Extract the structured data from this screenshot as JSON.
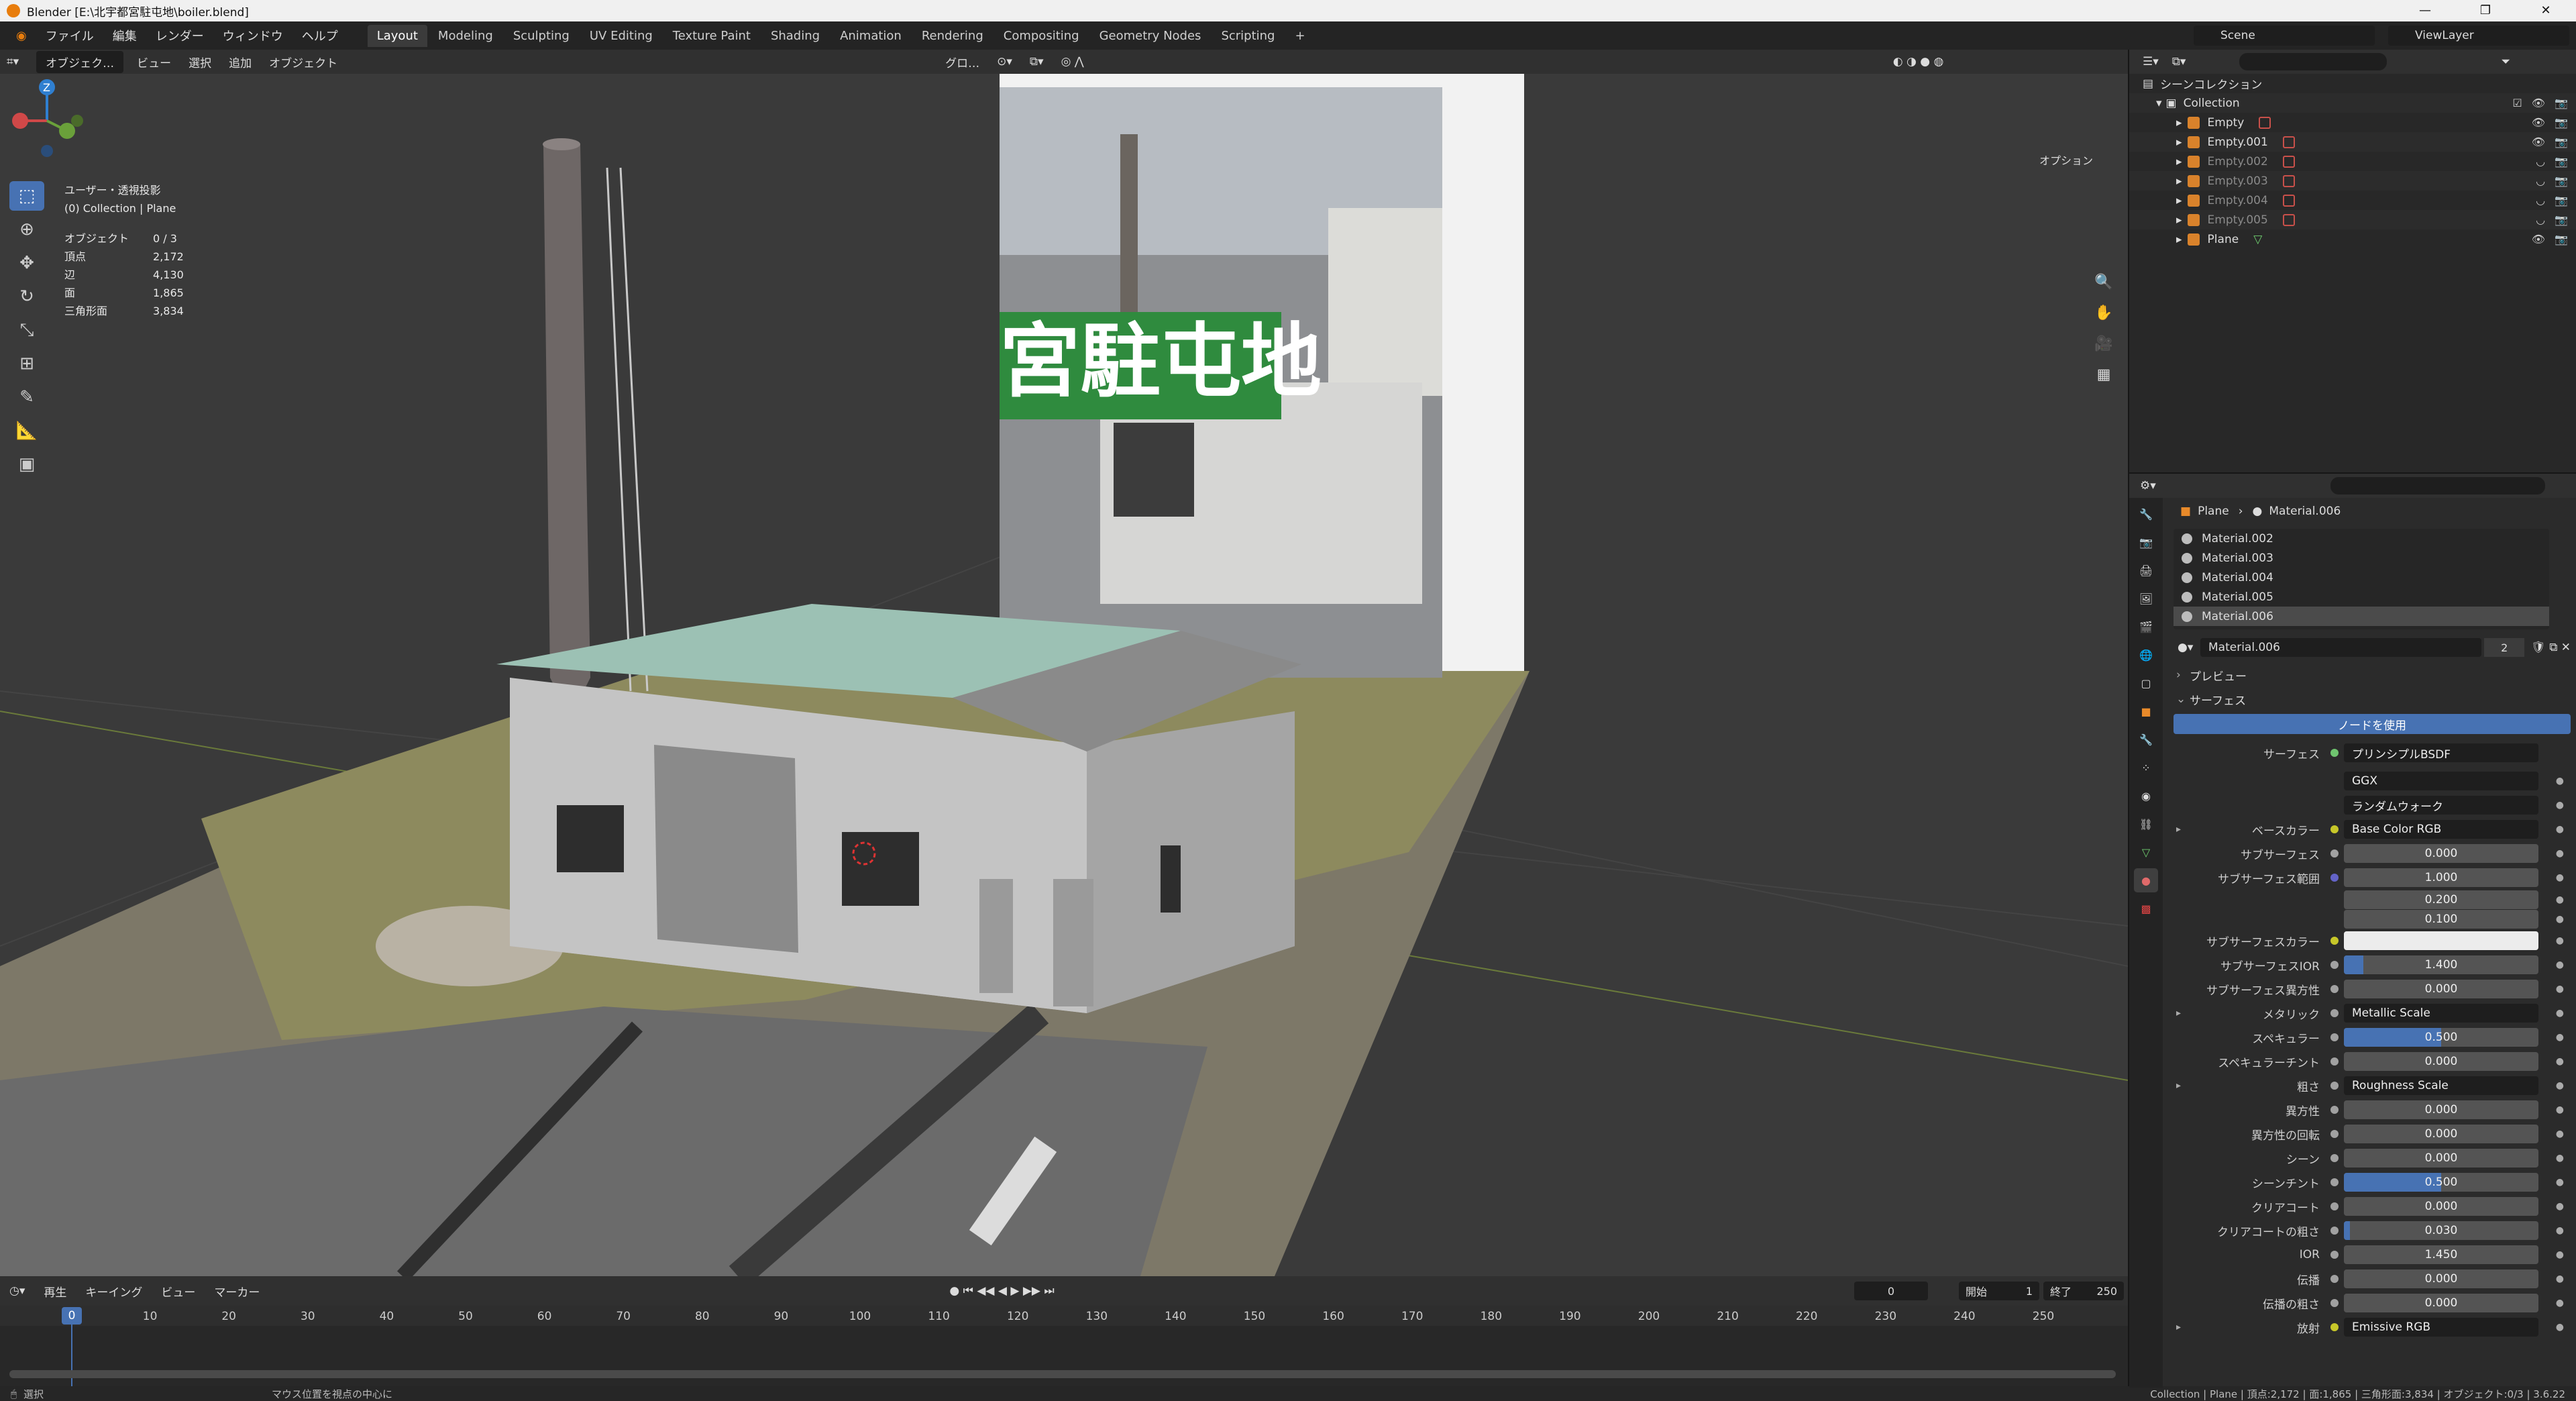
{
  "window": {
    "title": "Blender [E:\\北宇都宮駐屯地\\boiler.blend]"
  },
  "menu": [
    "ファイル",
    "編集",
    "レンダー",
    "ウィンドウ",
    "ヘルプ"
  ],
  "workspaces": [
    {
      "label": "Layout",
      "active": true
    },
    {
      "label": "Modeling"
    },
    {
      "label": "Sculpting"
    },
    {
      "label": "UV Editing"
    },
    {
      "label": "Texture Paint"
    },
    {
      "label": "Shading"
    },
    {
      "label": "Animation"
    },
    {
      "label": "Rendering"
    },
    {
      "label": "Compositing"
    },
    {
      "label": "Geometry Nodes"
    },
    {
      "label": "Scripting"
    }
  ],
  "scene": "Scene",
  "view_layer": "ViewLayer",
  "viewport_header": {
    "mode": "オブジェク…",
    "items": [
      "ビュー",
      "選択",
      "追加",
      "オブジェクト"
    ],
    "transform": "グロ…",
    "options": "オプション"
  },
  "viewport_info": {
    "view_name": "ユーザー・透視投影",
    "collection": "(0) Collection | Plane",
    "stats": [
      {
        "label": "オブジェクト",
        "value": "0 / 3"
      },
      {
        "label": "頂点",
        "value": "2,172"
      },
      {
        "label": "辺",
        "value": "4,130"
      },
      {
        "label": "面",
        "value": "1,865"
      },
      {
        "label": "三角形面",
        "value": "3,834"
      }
    ]
  },
  "billboard_text": "宮駐屯地",
  "outliner": {
    "root": "シーンコレクション",
    "collection": "Collection",
    "items": [
      {
        "name": "Empty",
        "dim": false
      },
      {
        "name": "Empty.001",
        "dim": false
      },
      {
        "name": "Empty.002",
        "dim": true
      },
      {
        "name": "Empty.003",
        "dim": true
      },
      {
        "name": "Empty.004",
        "dim": true
      },
      {
        "name": "Empty.005",
        "dim": true
      },
      {
        "name": "Plane",
        "dim": false
      }
    ]
  },
  "properties": {
    "breadcrumb_object": "Plane",
    "breadcrumb_material": "Material.006",
    "slots": [
      "Material.002",
      "Material.003",
      "Material.004",
      "Material.005",
      "Material.006"
    ],
    "selected_slot": "Material.006",
    "material_name": "Material.006",
    "material_users": "2",
    "preview_label": "プレビュー",
    "surface_panel": "サーフェス",
    "use_nodes": "ノードを使用",
    "surface_label": "サーフェス",
    "surface_shader": "プリンシプルBSDF",
    "distribution": "GGX",
    "subsurface_method": "ランダムウォーク",
    "rows": [
      {
        "label": "ベースカラー",
        "value": "Base Color RGB",
        "kind": "link",
        "socket": "#c7c729",
        "expander": true
      },
      {
        "label": "サブサーフェス",
        "value": "0.000",
        "kind": "num",
        "socket": "#a1a1a1"
      },
      {
        "label": "サブサーフェス範囲",
        "value": "1.000",
        "kind": "num",
        "socket": "#6363c7"
      },
      {
        "label": "",
        "value": "0.200",
        "kind": "num",
        "sub": true
      },
      {
        "label": "",
        "value": "0.100",
        "kind": "num",
        "sub": true
      },
      {
        "label": "サブサーフェスカラー",
        "value": "",
        "kind": "color",
        "socket": "#c7c729"
      },
      {
        "label": "サブサーフェスIOR",
        "value": "1.400",
        "kind": "num",
        "socket": "#a1a1a1",
        "fill": 0.1
      },
      {
        "label": "サブサーフェス異方性",
        "value": "0.000",
        "kind": "num",
        "socket": "#a1a1a1"
      },
      {
        "label": "メタリック",
        "value": "Metallic Scale",
        "kind": "link",
        "socket": "#a1a1a1",
        "expander": true
      },
      {
        "label": "スペキュラー",
        "value": "0.500",
        "kind": "num",
        "socket": "#a1a1a1",
        "fill": 0.5
      },
      {
        "label": "スペキュラーチント",
        "value": "0.000",
        "kind": "num",
        "socket": "#a1a1a1"
      },
      {
        "label": "粗さ",
        "value": "Roughness Scale",
        "kind": "link",
        "socket": "#a1a1a1",
        "expander": true
      },
      {
        "label": "異方性",
        "value": "0.000",
        "kind": "num",
        "socket": "#a1a1a1"
      },
      {
        "label": "異方性の回転",
        "value": "0.000",
        "kind": "num",
        "socket": "#a1a1a1"
      },
      {
        "label": "シーン",
        "value": "0.000",
        "kind": "num",
        "socket": "#a1a1a1"
      },
      {
        "label": "シーンチント",
        "value": "0.500",
        "kind": "num",
        "socket": "#a1a1a1",
        "fill": 0.5
      },
      {
        "label": "クリアコート",
        "value": "0.000",
        "kind": "num",
        "socket": "#a1a1a1"
      },
      {
        "label": "クリアコートの粗さ",
        "value": "0.030",
        "kind": "num",
        "socket": "#a1a1a1",
        "fill": 0.03
      },
      {
        "label": "IOR",
        "value": "1.450",
        "kind": "num",
        "socket": "#a1a1a1"
      },
      {
        "label": "伝播",
        "value": "0.000",
        "kind": "num",
        "socket": "#a1a1a1"
      },
      {
        "label": "伝播の粗さ",
        "value": "0.000",
        "kind": "num",
        "socket": "#a1a1a1"
      },
      {
        "label": "放射",
        "value": "Emissive RGB",
        "kind": "link",
        "socket": "#c7c729",
        "expander": true
      }
    ]
  },
  "timeline": {
    "menu": [
      "再生",
      "キーイング",
      "ビュー",
      "マーカー"
    ],
    "current_frame": "0",
    "start_label": "開始",
    "start": "1",
    "end_label": "終了",
    "end": "250",
    "ticks": [
      "0",
      "10",
      "20",
      "30",
      "40",
      "50",
      "60",
      "70",
      "80",
      "90",
      "100",
      "110",
      "120",
      "130",
      "140",
      "150",
      "160",
      "170",
      "180",
      "190",
      "200",
      "210",
      "220",
      "230",
      "240",
      "250"
    ]
  },
  "statusbar": {
    "left": "選択",
    "middle": "マウス位置を視点の中心に",
    "right": "Collection | Plane | 頂点:2,172 | 面:1,865 | 三角形面:3,834 | オブジェクト:0/3 | 3.6.22"
  }
}
